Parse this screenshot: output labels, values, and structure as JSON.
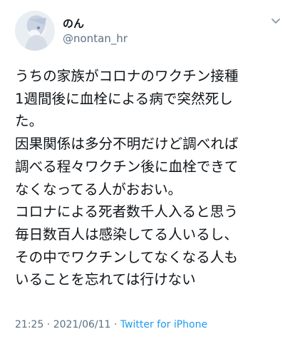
{
  "user": {
    "display_name": "のん",
    "handle": "@nontan_hr"
  },
  "tweet": {
    "lines": [
      "うちの家族がコロナのワクチン接種",
      "1週間後に血栓による病で突然死し",
      "た。",
      "因果関係は多分不明だけど調べれば",
      "調べる程々ワクチン後に血栓できて",
      "なくなってる人がおおい。",
      "コロナによる死者数千人入ると思う",
      "毎日数百人は感染してる人いるし、",
      "その中でワクチンしてなくなる人も",
      "いることを忘れては行けない"
    ]
  },
  "meta": {
    "time": "21:25",
    "separator1": " · ",
    "date": "2021/06/11",
    "separator2": " · ",
    "source": "Twitter for iPhone"
  },
  "icons": {
    "avatar": "avatar-image",
    "more": "chevron-down-icon"
  },
  "colors": {
    "text": "#0f1419",
    "secondary": "#5b7083",
    "link": "#1d9bf0"
  }
}
